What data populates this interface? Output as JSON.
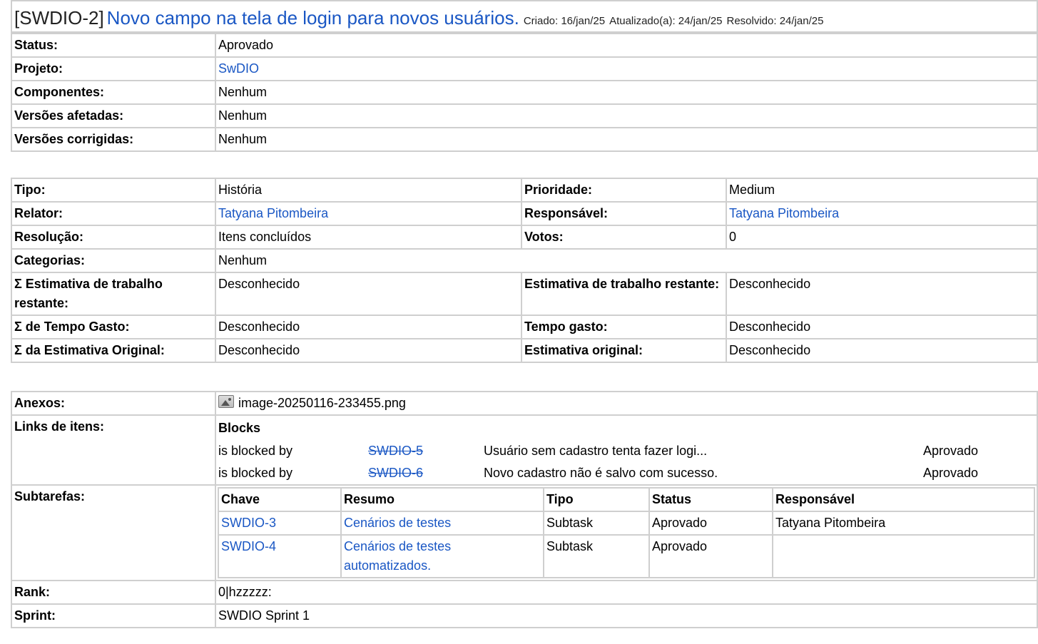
{
  "header": {
    "key": "[SWDIO-2]",
    "title": "Novo campo na tela de login para novos usuários.",
    "created": "Criado: 16/jan/25",
    "updated": "Atualizado(a): 24/jan/25",
    "resolved": "Resolvido: 24/jan/25"
  },
  "details": [
    {
      "label": "Status:",
      "value": "Aprovado"
    },
    {
      "label": "Projeto:",
      "value": "SwDIO"
    },
    {
      "label": "Componentes:",
      "value": "Nenhum"
    },
    {
      "label": "Versões afetadas:",
      "value": "Nenhum"
    },
    {
      "label": "Versões corrigidas:",
      "value": "Nenhum"
    }
  ],
  "people": {
    "tipo_label": "Tipo:",
    "tipo": "História",
    "prioridade_label": "Prioridade:",
    "prioridade": "Medium",
    "relator_label": "Relator:",
    "relator": "Tatyana Pitombeira",
    "responsavel_label": "Responsável:",
    "responsavel": "Tatyana Pitombeira",
    "resolucao_label": "Resolução:",
    "resolucao": "Itens concluídos",
    "votos_label": "Votos:",
    "votos": "0",
    "categorias_label": "Categorias:",
    "categorias": "Nenhum",
    "sum_restante_label": "Σ Estimativa de trabalho restante:",
    "sum_restante": "Desconhecido",
    "restante_label": "Estimativa de trabalho restante:",
    "restante": "Desconhecido",
    "sum_gasto_label": "Σ de Tempo Gasto:",
    "sum_gasto": "Desconhecido",
    "gasto_label": "Tempo gasto:",
    "gasto": "Desconhecido",
    "sum_original_label": "Σ da Estimativa Original:",
    "sum_original": "Desconhecido",
    "original_label": "Estimativa original:",
    "original": "Desconhecido"
  },
  "extra": {
    "anexos_label": "Anexos:",
    "anexo_file": "image-20250116-233455.png",
    "links_label": "Links de itens:",
    "links_group": "Blocks",
    "links": [
      {
        "relation": "is blocked by",
        "key": "SWDIO-5",
        "summary": "Usuário sem cadastro tenta fazer logi...",
        "status": "Aprovado"
      },
      {
        "relation": "is blocked by",
        "key": "SWDIO-6",
        "summary": "Novo cadastro não é salvo com sucesso.",
        "status": "Aprovado"
      }
    ],
    "subtarefas_label": "Subtarefas:",
    "sub_headers": [
      "Chave",
      "Resumo",
      "Tipo",
      "Status",
      "Responsável"
    ],
    "subtasks": [
      {
        "key": "SWDIO-3",
        "summary": "Cenários de testes",
        "type": "Subtask",
        "status": "Aprovado",
        "assignee": "Tatyana Pitombeira"
      },
      {
        "key": "SWDIO-4",
        "summary": "Cenários de testes automatizados.",
        "type": "Subtask",
        "status": "Aprovado",
        "assignee": ""
      }
    ],
    "rank_label": "Rank:",
    "rank": "0|hzzzzz:",
    "sprint_label": "Sprint:",
    "sprint": "SWDIO Sprint 1"
  }
}
